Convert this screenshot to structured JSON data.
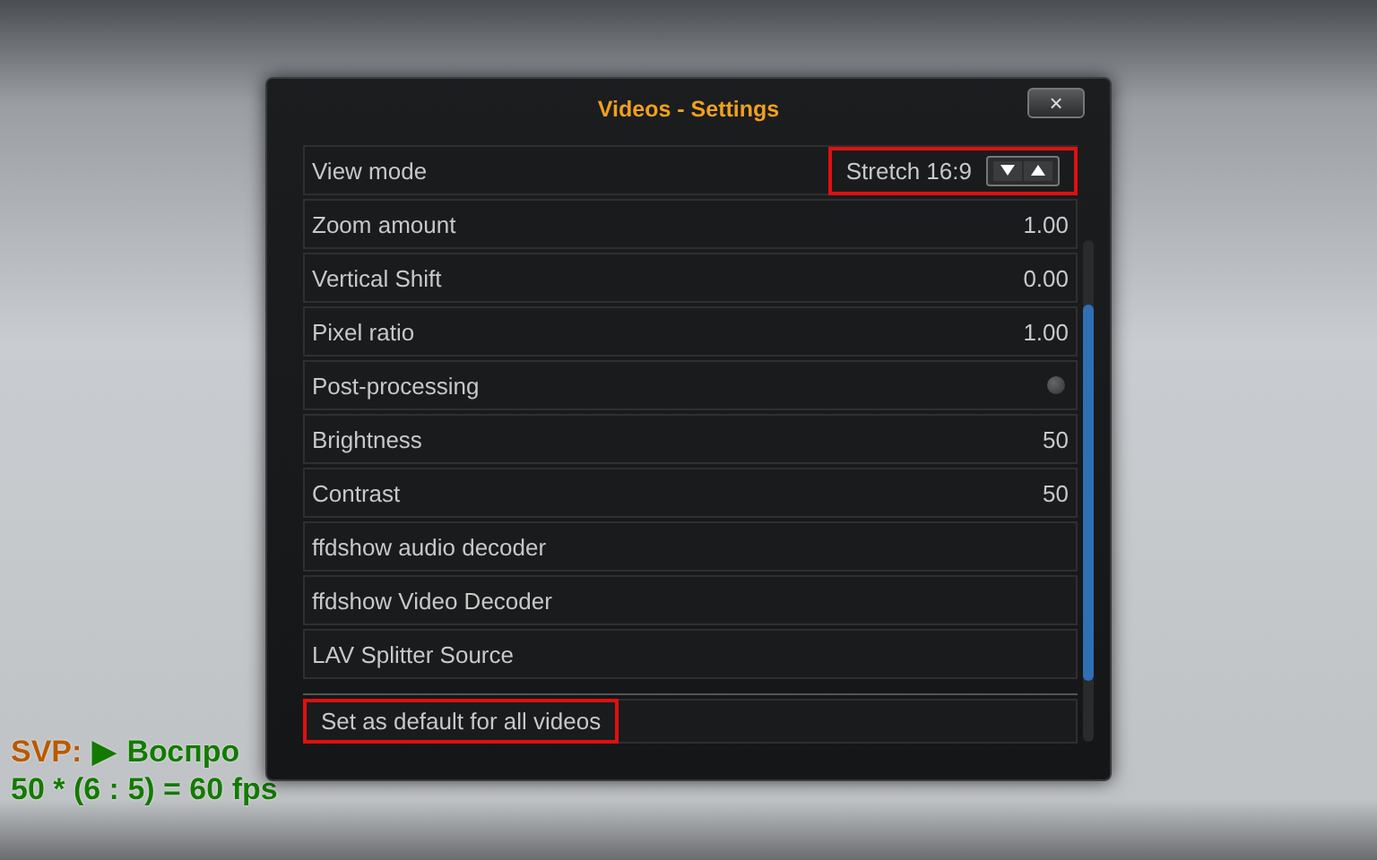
{
  "osd": {
    "label": "SVP:",
    "play_symbol": "▶",
    "status": "Воспро",
    "rate": "50 * (6 : 5) = 60 fps"
  },
  "dialog": {
    "title": "Videos - Settings",
    "close": "×",
    "rows": [
      {
        "kind": "spin",
        "label": "View mode",
        "value": "Stretch 16:9",
        "annotated": true
      },
      {
        "kind": "value",
        "label": "Zoom amount",
        "value": "1.00",
        "annotated": false
      },
      {
        "kind": "value",
        "label": "Vertical Shift",
        "value": "0.00",
        "annotated": false
      },
      {
        "kind": "value",
        "label": "Pixel ratio",
        "value": "1.00",
        "annotated": false
      },
      {
        "kind": "toggle",
        "label": "Post-processing",
        "on": false,
        "annotated": false
      },
      {
        "kind": "value",
        "label": "Brightness",
        "value": "50",
        "annotated": false
      },
      {
        "kind": "value",
        "label": "Contrast",
        "value": "50",
        "annotated": false
      },
      {
        "kind": "button",
        "label": "ffdshow audio decoder",
        "annotated": false
      },
      {
        "kind": "button",
        "label": "ffdshow Video Decoder",
        "annotated": false
      },
      {
        "kind": "button",
        "label": "LAV Splitter Source",
        "annotated": false
      }
    ],
    "footer": {
      "label": "Set as default for all videos",
      "annotated": true
    }
  }
}
